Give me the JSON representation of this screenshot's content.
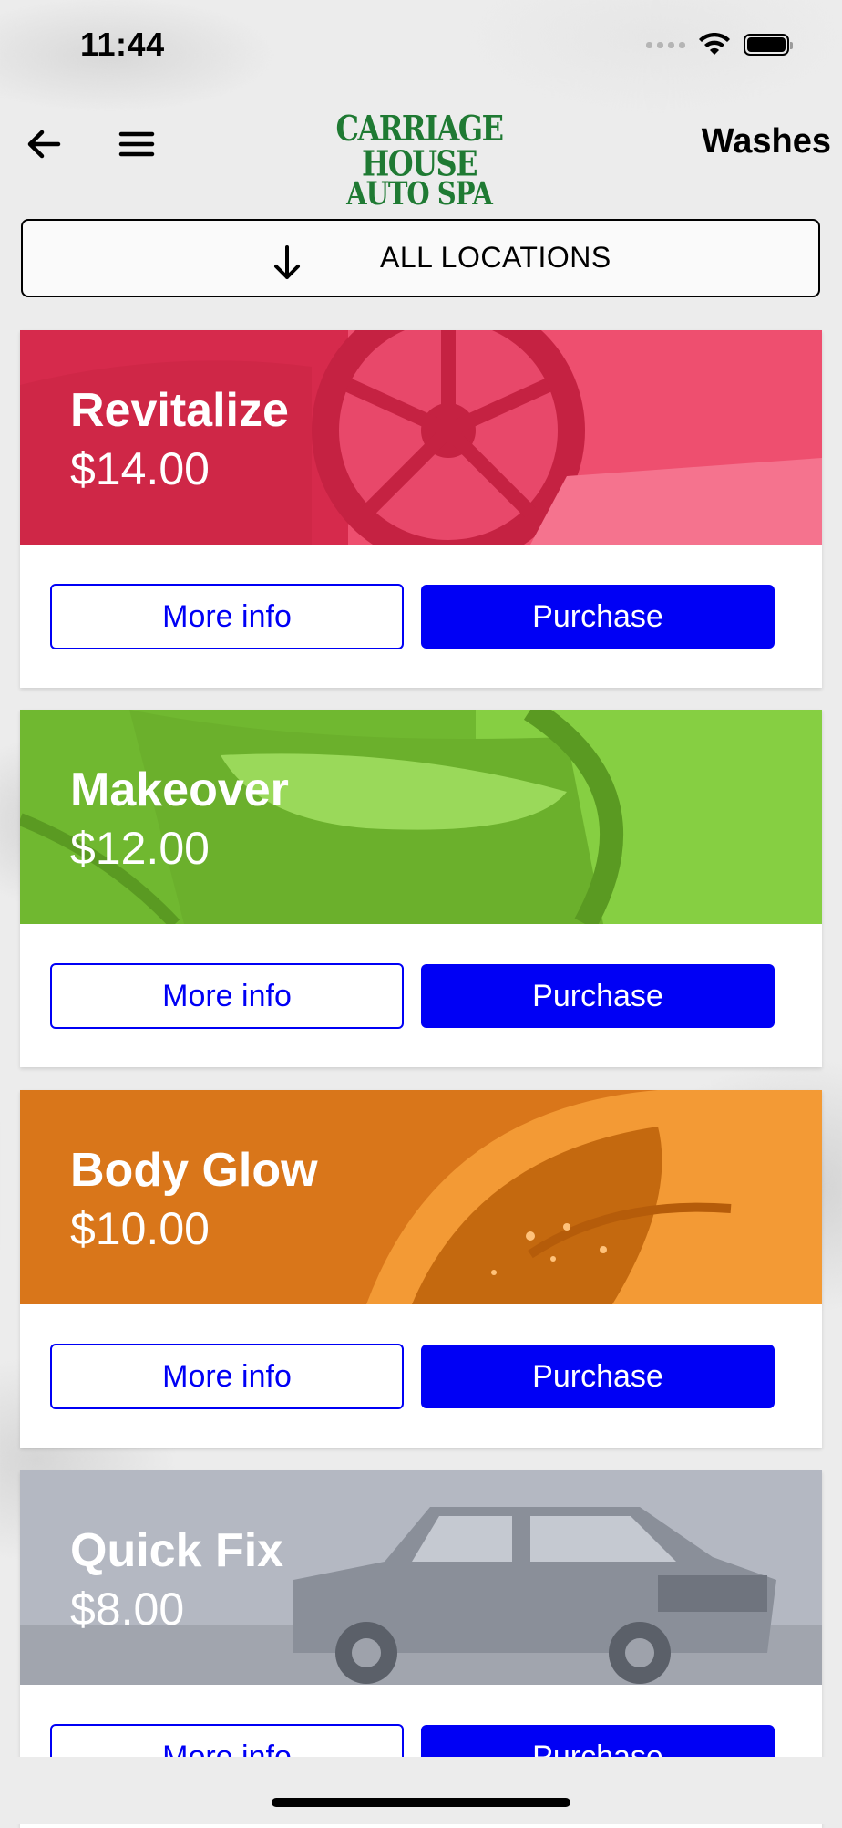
{
  "status_bar": {
    "time": "11:44",
    "icons": [
      "cellular-signal-icon",
      "wifi-icon",
      "battery-icon"
    ]
  },
  "nav": {
    "back_icon": "arrow-left-icon",
    "menu_icon": "hamburger-menu-icon",
    "logo_line1": "CARRIAGE HOUSE",
    "logo_line2": "AUTO SPA",
    "title": "Washes"
  },
  "location_selector": {
    "icon": "arrow-down-icon",
    "label": "ALL LOCATIONS"
  },
  "washes": [
    {
      "name": "Revitalize",
      "price": "$14.00",
      "color": "#e53a5c",
      "image": "car-wheel-image",
      "more_info_label": "More info",
      "purchase_label": "Purchase"
    },
    {
      "name": "Makeover",
      "price": "$12.00",
      "color": "#7cc63a",
      "image": "car-headlight-image",
      "more_info_label": "More info",
      "purchase_label": "Purchase"
    },
    {
      "name": "Body Glow",
      "price": "$10.00",
      "color": "#ec8a1e",
      "image": "wet-car-fender-image",
      "more_info_label": "More info",
      "purchase_label": "Purchase"
    },
    {
      "name": "Quick Fix",
      "price": "$8.00",
      "color": "#aeb2bc",
      "image": "pickup-truck-image",
      "more_info_label": "More info",
      "purchase_label": "Purchase"
    }
  ],
  "colors": {
    "accent_blue": "#0000f5",
    "logo_green": "#1f7a33"
  }
}
